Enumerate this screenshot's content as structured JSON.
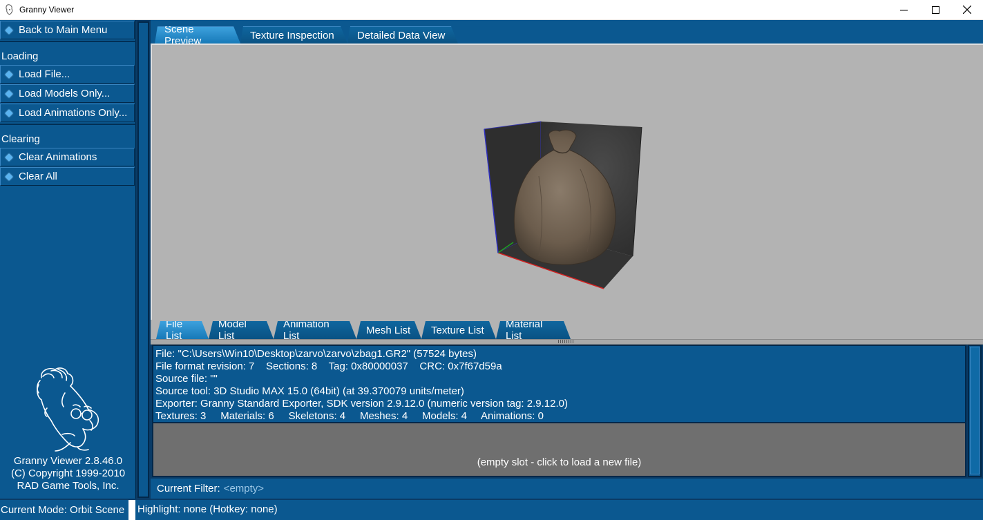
{
  "window": {
    "title": "Granny Viewer"
  },
  "sidebar": {
    "back_label": "Back to Main Menu",
    "loading_label": "Loading",
    "loading_items": [
      "Load File...",
      "Load Models Only...",
      "Load Animations Only..."
    ],
    "clearing_label": "Clearing",
    "clearing_items": [
      "Clear Animations",
      "Clear All"
    ],
    "about": {
      "version": "Granny Viewer 2.8.46.0",
      "copyright": "(C) Copyright 1999-2010",
      "company": "RAD Game Tools, Inc."
    }
  },
  "view_tabs": [
    "Scene Preview",
    "Texture Inspection",
    "Detailed Data View"
  ],
  "list_tabs": [
    "File List",
    "Model List",
    "Animation List",
    "Mesh List",
    "Texture List",
    "Material List"
  ],
  "file_info": {
    "file": "File: \"C:\\Users\\Win10\\Desktop\\zarvo\\zarvo\\zbag1.GR2\" (57524 bytes)",
    "format": "File format revision: 7    Sections: 8    Tag: 0x80000037    CRC: 0x7f67d59a",
    "source_file": "Source file: \"\"",
    "source_tool": "Source tool: 3D Studio MAX 15.0 (64bit) (at 39.370079 units/meter)",
    "exporter": "Exporter: Granny Standard Exporter, SDK version 2.9.12.0 (numeric version tag: 2.9.12.0)",
    "counts": "Textures: 3     Materials: 6     Skeletons: 4     Meshes: 4     Models: 4     Animations: 0"
  },
  "empty_slot": "(empty slot - click to load a new file)",
  "filter": {
    "label": "Current Filter:",
    "value": "<empty>"
  },
  "status": {
    "mode": "Current Mode: Orbit Scene",
    "highlight": "Highlight: none (Hotkey: none)"
  },
  "colors": {
    "panel_blue": "#0b5890",
    "active_tab": "#2a8ccb",
    "viewport_gray": "#b3b3b3"
  }
}
